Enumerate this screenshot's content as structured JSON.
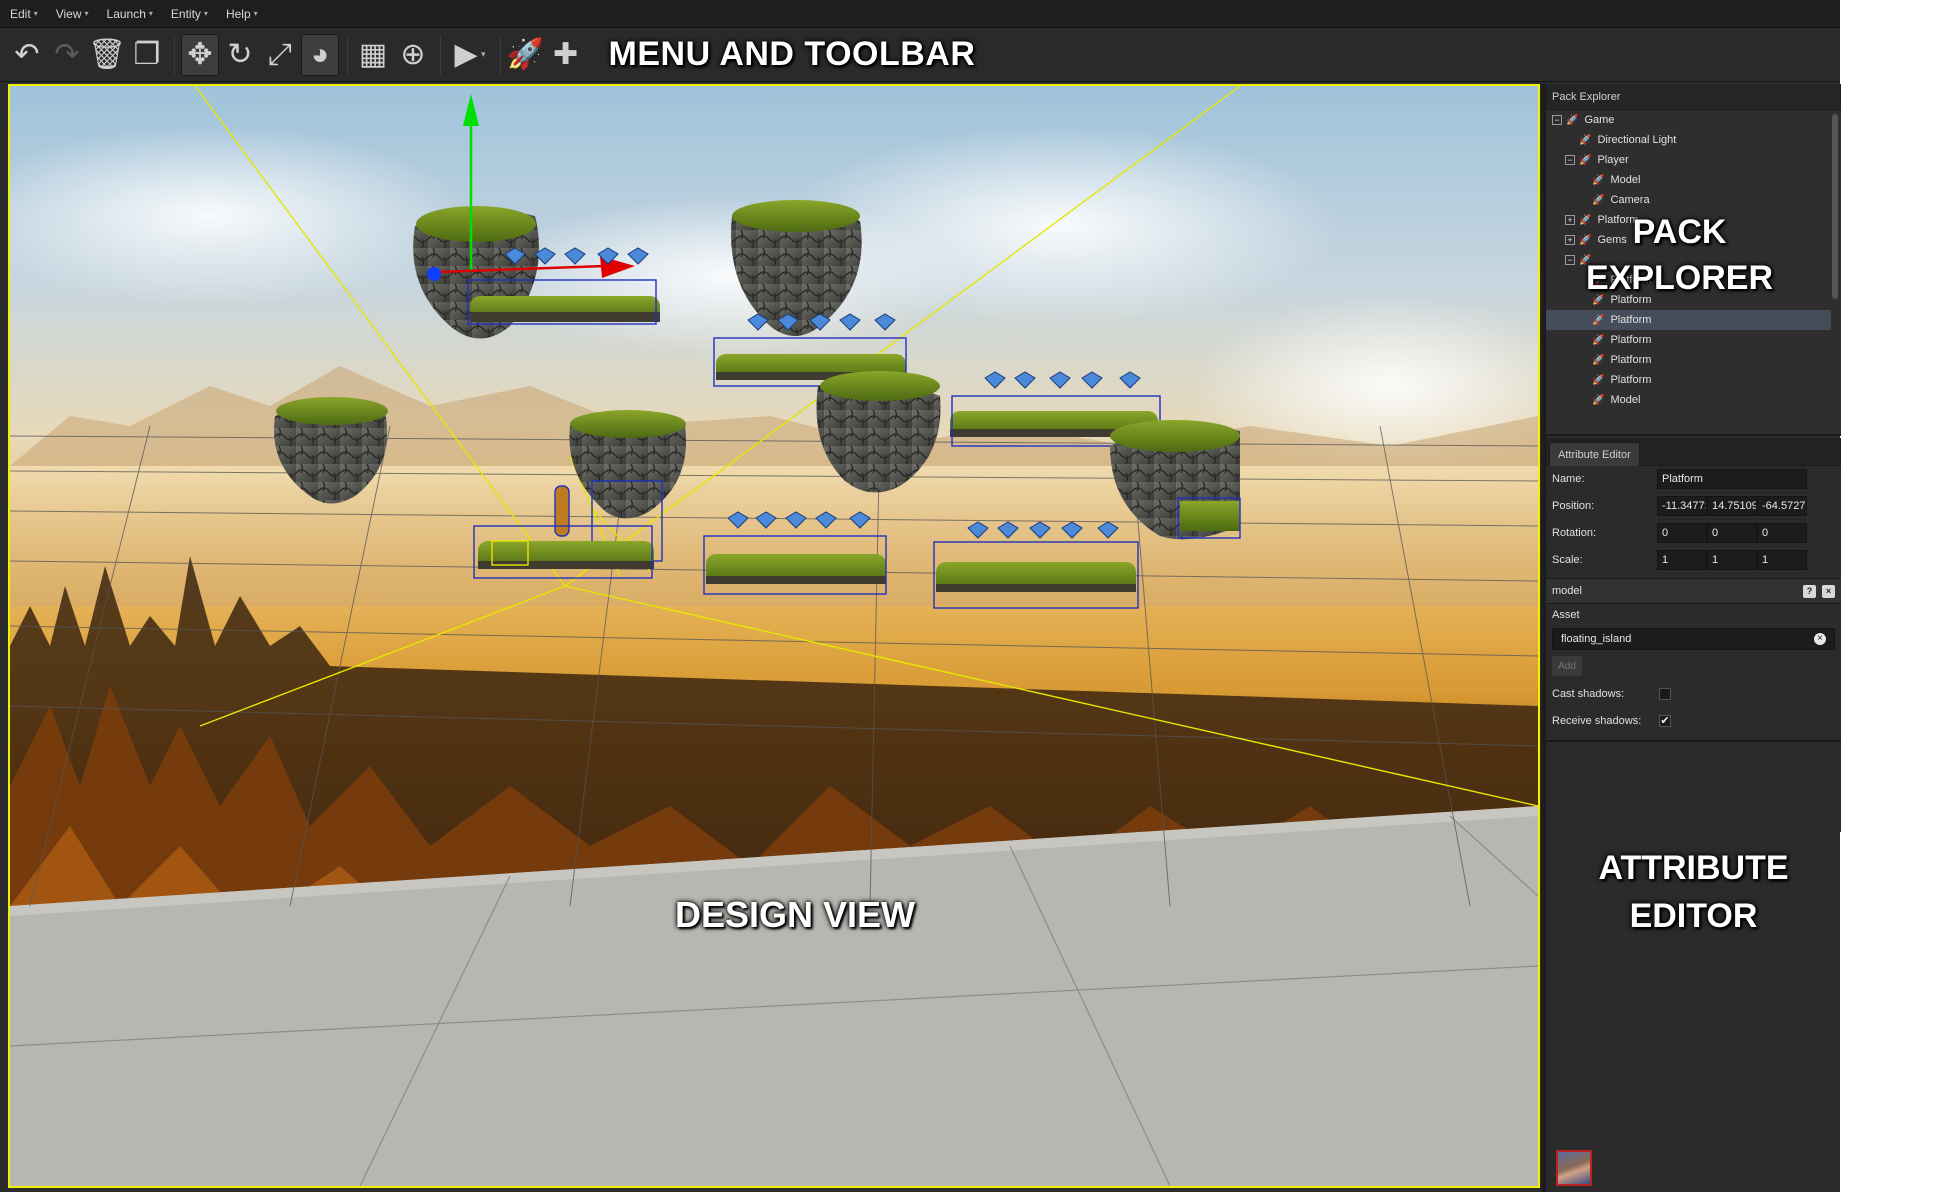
{
  "menu": {
    "items": [
      {
        "label": "Edit"
      },
      {
        "label": "View"
      },
      {
        "label": "Launch"
      },
      {
        "label": "Entity"
      },
      {
        "label": "Help"
      }
    ]
  },
  "toolbar": {
    "buttons": [
      {
        "icon": "undo-icon",
        "glyph": "↶"
      },
      {
        "icon": "redo-icon",
        "glyph": "↷"
      },
      {
        "icon": "trash-icon",
        "glyph": "🗑"
      },
      {
        "icon": "duplicate-icon",
        "glyph": "❐"
      },
      {
        "icon": "move-icon",
        "glyph": "✥"
      },
      {
        "icon": "rotate-icon",
        "glyph": "↻"
      },
      {
        "icon": "scale-icon",
        "glyph": "⤢"
      },
      {
        "icon": "globe-icon",
        "glyph": "◕"
      },
      {
        "icon": "layout-icon",
        "glyph": "▦"
      },
      {
        "icon": "zoom-icon",
        "glyph": "⊕"
      },
      {
        "icon": "play-icon",
        "glyph": "▶"
      },
      {
        "icon": "rocket-icon",
        "glyph": "🚀"
      },
      {
        "icon": "puzzle-icon",
        "glyph": "✚"
      }
    ],
    "annotation": "MENU AND TOOLBAR"
  },
  "design_view": {
    "annotation": "DESIGN VIEW"
  },
  "pack_explorer": {
    "title": "Pack Explorer",
    "annotation_line1": "PACK",
    "annotation_line2": "EXPLORER",
    "tree": [
      {
        "label": "Game",
        "depth": 0,
        "toggle": "minus"
      },
      {
        "label": "Directional Light",
        "depth": 1,
        "toggle": "none"
      },
      {
        "label": "Player",
        "depth": 1,
        "toggle": "minus"
      },
      {
        "label": "Model",
        "depth": 2,
        "toggle": "none"
      },
      {
        "label": "Camera",
        "depth": 2,
        "toggle": "none"
      },
      {
        "label": "Platform",
        "depth": 1,
        "toggle": "plus"
      },
      {
        "label": "Gems",
        "depth": 1,
        "toggle": "plus"
      },
      {
        "label": "",
        "depth": 1,
        "toggle": "minus"
      },
      {
        "label": "Platform",
        "depth": 2,
        "toggle": "none"
      },
      {
        "label": "Platform",
        "depth": 2,
        "toggle": "none"
      },
      {
        "label": "Platform",
        "depth": 2,
        "toggle": "none",
        "selected": true
      },
      {
        "label": "Platform",
        "depth": 2,
        "toggle": "none"
      },
      {
        "label": "Platform",
        "depth": 2,
        "toggle": "none"
      },
      {
        "label": "Platform",
        "depth": 2,
        "toggle": "none"
      },
      {
        "label": "Model",
        "depth": 2,
        "toggle": "none"
      }
    ]
  },
  "attribute_editor": {
    "tab": "Attribute Editor",
    "annotation_line1": "ATTRIBUTE",
    "annotation_line2": "EDITOR",
    "name_label": "Name:",
    "name_value": "Platform",
    "position_label": "Position:",
    "position": [
      "-11.3477:",
      "14.75109",
      "-64.5727!"
    ],
    "rotation_label": "Rotation:",
    "rotation": [
      "0",
      "0",
      "0"
    ],
    "scale_label": "Scale:",
    "scale": [
      "1",
      "1",
      "1"
    ],
    "component": "model",
    "help_glyph": "?",
    "close_glyph": "×",
    "asset_label": "Asset",
    "asset_value": "floating_island",
    "add_label": "Add",
    "cast_shadows_label": "Cast shadows:",
    "cast_shadows": false,
    "receive_shadows_label": "Receive shadows:",
    "receive_shadows": true
  },
  "colors": {
    "selection_border": "#f0f000",
    "panel_bg": "#2b2b2b",
    "selected_row": "#454c5a"
  }
}
